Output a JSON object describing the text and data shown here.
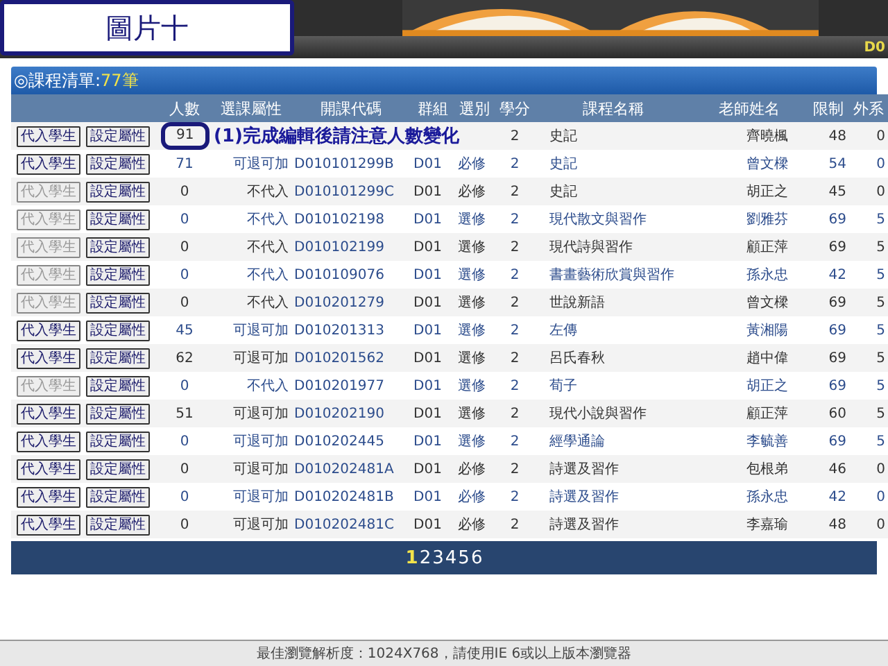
{
  "overlay_label": "圖片十",
  "banner": {
    "bar_code": "D0"
  },
  "panel": {
    "title": "◎課程清單:",
    "count": "77筆"
  },
  "columns": [
    "人數",
    "選課屬性",
    "開課代碼",
    "群組",
    "選別",
    "學分",
    "課程名稱",
    "老師姓名",
    "限制",
    "外系"
  ],
  "rows": [
    {
      "inject": "代入學生",
      "inject_disabled": false,
      "setattr": "設定屬性",
      "count": "91",
      "circled": true,
      "annotation": "(1)完成編輯後請注意人數變化",
      "credits": "2",
      "name": "史記",
      "teacher": "齊曉楓",
      "limit": "48",
      "outside": "0"
    },
    {
      "inject": "代入學生",
      "inject_disabled": false,
      "setattr": "設定屬性",
      "count": "71",
      "attr": "可退可加",
      "code": "D010101299B",
      "group": "D01",
      "type": "必修",
      "credits": "2",
      "name": "史記",
      "teacher": "曾文樑",
      "limit": "54",
      "outside": "0"
    },
    {
      "inject": "代入學生",
      "inject_disabled": true,
      "setattr": "設定屬性",
      "count": "0",
      "attr": "不代入",
      "code": "D010101299C",
      "group": "D01",
      "type": "必修",
      "credits": "2",
      "name": "史記",
      "teacher": "胡正之",
      "limit": "45",
      "outside": "0"
    },
    {
      "inject": "代入學生",
      "inject_disabled": true,
      "setattr": "設定屬性",
      "count": "0",
      "attr": "不代入",
      "code": "D010102198",
      "group": "D01",
      "type": "選修",
      "credits": "2",
      "name": "現代散文與習作",
      "teacher": "劉雅芬",
      "limit": "69",
      "outside": "5"
    },
    {
      "inject": "代入學生",
      "inject_disabled": true,
      "setattr": "設定屬性",
      "count": "0",
      "attr": "不代入",
      "code": "D010102199",
      "group": "D01",
      "type": "選修",
      "credits": "2",
      "name": "現代詩與習作",
      "teacher": "顧正萍",
      "limit": "69",
      "outside": "5"
    },
    {
      "inject": "代入學生",
      "inject_disabled": true,
      "setattr": "設定屬性",
      "count": "0",
      "attr": "不代入",
      "code": "D010109076",
      "group": "D01",
      "type": "選修",
      "credits": "2",
      "name": "書畫藝術欣賞與習作",
      "teacher": "孫永忠",
      "limit": "42",
      "outside": "5"
    },
    {
      "inject": "代入學生",
      "inject_disabled": true,
      "setattr": "設定屬性",
      "count": "0",
      "attr": "不代入",
      "code": "D010201279",
      "group": "D01",
      "type": "選修",
      "credits": "2",
      "name": "世說新語",
      "teacher": "曾文樑",
      "limit": "69",
      "outside": "5"
    },
    {
      "inject": "代入學生",
      "inject_disabled": false,
      "setattr": "設定屬性",
      "count": "45",
      "attr": "可退可加",
      "code": "D010201313",
      "group": "D01",
      "type": "選修",
      "credits": "2",
      "name": "左傳",
      "teacher": "黃湘陽",
      "limit": "69",
      "outside": "5"
    },
    {
      "inject": "代入學生",
      "inject_disabled": false,
      "setattr": "設定屬性",
      "count": "62",
      "attr": "可退可加",
      "code": "D010201562",
      "group": "D01",
      "type": "選修",
      "credits": "2",
      "name": "呂氏春秋",
      "teacher": "趙中偉",
      "limit": "69",
      "outside": "5"
    },
    {
      "inject": "代入學生",
      "inject_disabled": true,
      "setattr": "設定屬性",
      "count": "0",
      "attr": "不代入",
      "code": "D010201977",
      "group": "D01",
      "type": "選修",
      "credits": "2",
      "name": "荀子",
      "teacher": "胡正之",
      "limit": "69",
      "outside": "5"
    },
    {
      "inject": "代入學生",
      "inject_disabled": false,
      "setattr": "設定屬性",
      "count": "51",
      "attr": "可退可加",
      "code": "D010202190",
      "group": "D01",
      "type": "選修",
      "credits": "2",
      "name": "現代小說與習作",
      "teacher": "顧正萍",
      "limit": "60",
      "outside": "5"
    },
    {
      "inject": "代入學生",
      "inject_disabled": false,
      "setattr": "設定屬性",
      "count": "0",
      "attr": "可退可加",
      "code": "D010202445",
      "group": "D01",
      "type": "選修",
      "credits": "2",
      "name": "經學通論",
      "teacher": "李毓善",
      "limit": "69",
      "outside": "5"
    },
    {
      "inject": "代入學生",
      "inject_disabled": false,
      "setattr": "設定屬性",
      "count": "0",
      "attr": "可退可加",
      "code": "D010202481A",
      "group": "D01",
      "type": "必修",
      "credits": "2",
      "name": "詩選及習作",
      "teacher": "包根弟",
      "limit": "46",
      "outside": "0"
    },
    {
      "inject": "代入學生",
      "inject_disabled": false,
      "setattr": "設定屬性",
      "count": "0",
      "attr": "可退可加",
      "code": "D010202481B",
      "group": "D01",
      "type": "必修",
      "credits": "2",
      "name": "詩選及習作",
      "teacher": "孫永忠",
      "limit": "42",
      "outside": "0"
    },
    {
      "inject": "代入學生",
      "inject_disabled": false,
      "setattr": "設定屬性",
      "count": "0",
      "attr": "可退可加",
      "code": "D010202481C",
      "group": "D01",
      "type": "必修",
      "credits": "2",
      "name": "詩選及習作",
      "teacher": "李嘉瑜",
      "limit": "48",
      "outside": "0"
    }
  ],
  "pages": [
    {
      "label": "1",
      "selected": true
    },
    {
      "label": "2",
      "selected": false
    },
    {
      "label": "3",
      "selected": false
    },
    {
      "label": "4",
      "selected": false
    },
    {
      "label": "5",
      "selected": false
    },
    {
      "label": "6",
      "selected": false
    }
  ],
  "footer": "最佳瀏覽解析度：1024X768，請使用IE 6或以上版本瀏覽器"
}
